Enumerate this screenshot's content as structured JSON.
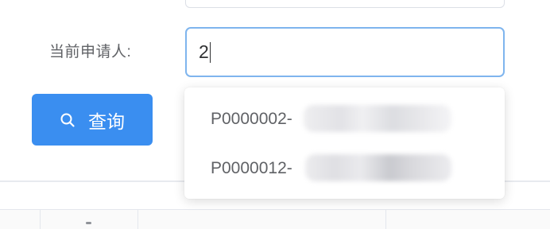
{
  "form": {
    "applicant_label": "当前申请人:",
    "applicant_value": "2"
  },
  "toolbar": {
    "query_label": "查询",
    "query_icon": "search-icon"
  },
  "autocomplete": {
    "options": [
      {
        "label": "P0000002-"
      },
      {
        "label": "P0000012-"
      }
    ]
  },
  "colors": {
    "primary": "#3a8ef0",
    "input_focus_border": "#7fb5ee",
    "label_text": "#606266"
  }
}
